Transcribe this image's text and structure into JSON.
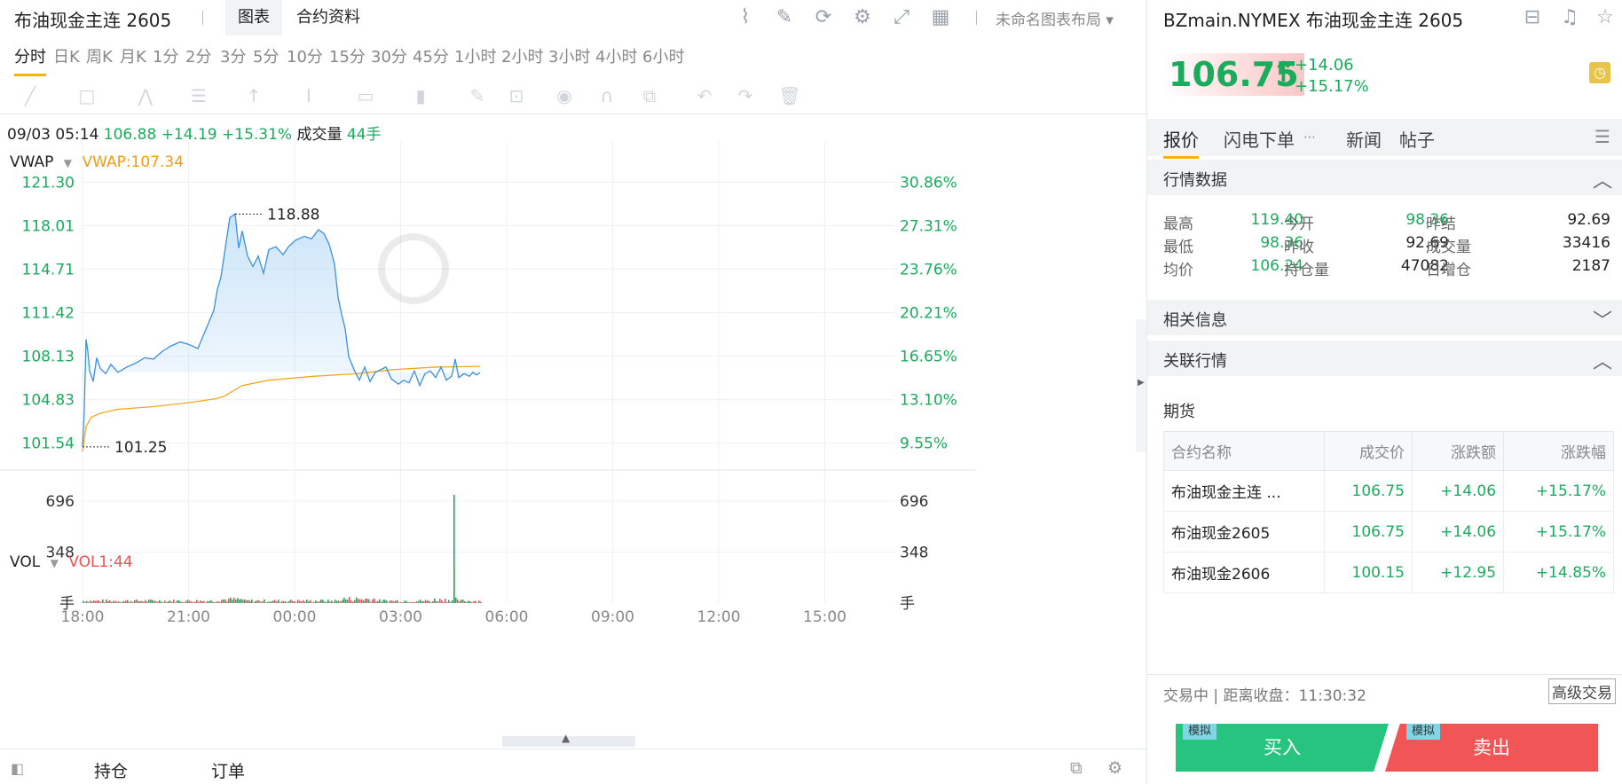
{
  "header": {
    "instrument_title": "布油现金主连 2605",
    "tabs": [
      "图表",
      "合约资料"
    ],
    "layout_name": "未命名图表布局"
  },
  "intervals": [
    "分时",
    "日K",
    "周K",
    "月K",
    "1分",
    "2分",
    "3分",
    "5分",
    "10分",
    "15分",
    "30分",
    "45分",
    "1小时",
    "2小时",
    "3小时",
    "4小时",
    "6小时"
  ],
  "info_line": {
    "datetime": "09/03 05:14",
    "price": "106.88",
    "change": "+14.19",
    "pct": "+15.31%",
    "volume_label": "成交量",
    "volume": "44手"
  },
  "indicators": {
    "vwap_name": "VWAP",
    "vwap_value": "VWAP:107.34",
    "vol_name": "VOL",
    "vol_value": "VOL1:44"
  },
  "chart_data": {
    "type": "line",
    "price_ticks": [
      "121.30",
      "118.01",
      "114.71",
      "111.42",
      "108.13",
      "104.83",
      "101.54"
    ],
    "pct_ticks": [
      "30.86%",
      "27.31%",
      "23.76%",
      "20.21%",
      "16.65%",
      "13.10%",
      "9.55%"
    ],
    "time_ticks": [
      "18:00",
      "21:00",
      "00:00",
      "03:00",
      "06:00",
      "09:00",
      "12:00",
      "15:00"
    ],
    "ylim": [
      99.5,
      123.0
    ],
    "high_marker": "118.88",
    "low_marker": "101.25",
    "vol_ticks": [
      "696",
      "348"
    ],
    "vol_unit": "手",
    "vol_max": 800,
    "series": [
      {
        "name": "VWAP",
        "color": "#f5a623",
        "x": [
          0,
          4,
          10,
          20,
          40,
          80,
          120,
          150,
          160,
          180,
          210,
          260,
          310,
          350,
          400,
          448
        ],
        "values": [
          100.9,
          102.8,
          103.5,
          103.8,
          104.1,
          104.3,
          104.6,
          104.9,
          105.1,
          105.9,
          106.3,
          106.6,
          106.8,
          107.1,
          107.3,
          107.34
        ]
      },
      {
        "name": "price",
        "color": "#3b8fe0",
        "x": [
          0,
          2,
          4,
          6,
          8,
          12,
          16,
          20,
          26,
          32,
          40,
          50,
          60,
          70,
          80,
          90,
          100,
          110,
          120,
          130,
          140,
          148,
          152,
          156,
          160,
          166,
          172,
          176,
          180,
          186,
          192,
          198,
          204,
          210,
          218,
          226,
          232,
          240,
          250,
          258,
          266,
          272,
          278,
          284,
          288,
          292,
          296,
          300,
          306,
          312,
          318,
          324,
          330,
          336,
          342,
          348,
          356,
          362,
          368,
          374,
          380,
          386,
          392,
          398,
          404,
          410,
          416,
          420,
          424,
          430,
          436,
          440,
          444,
          448
        ],
        "values": [
          101.25,
          104.0,
          109.4,
          108.5,
          107.0,
          106.2,
          108.0,
          107.2,
          106.8,
          107.5,
          106.9,
          107.3,
          107.6,
          108.0,
          107.9,
          108.5,
          108.9,
          109.2,
          109.0,
          108.7,
          110.3,
          111.6,
          113.2,
          114.1,
          115.9,
          118.6,
          118.9,
          116.3,
          117.6,
          115.7,
          114.9,
          115.7,
          114.4,
          116.2,
          116.4,
          115.8,
          116.4,
          116.9,
          117.2,
          117.0,
          117.7,
          117.4,
          116.6,
          115.1,
          112.6,
          111.3,
          110.2,
          108.1,
          107.1,
          106.3,
          107.3,
          106.2,
          106.9,
          107.1,
          107.3,
          106.4,
          106.0,
          106.3,
          106.1,
          107.0,
          105.9,
          106.8,
          107.0,
          106.5,
          107.3,
          106.3,
          106.6,
          107.9,
          106.5,
          106.8,
          106.6,
          106.9,
          106.7,
          106.88
        ]
      }
    ],
    "volume_peak": {
      "x": 418,
      "value": 740
    }
  },
  "bottom_tabs": [
    "持仓",
    "订单"
  ],
  "quote": {
    "title": "BZmain.NYMEX 布油现金主连 2605",
    "price": "106.75",
    "change": "+14.06",
    "pct": "+15.17%",
    "tabs": [
      "报价",
      "闪电下单",
      "新闻",
      "帖子"
    ],
    "market_data_title": "行情数据",
    "market_data": [
      [
        "最高",
        "119.40",
        "今开",
        "98.36",
        "昨结",
        "92.69"
      ],
      [
        "最低",
        "98.36",
        "昨收",
        "92.69",
        "成交量",
        "33416"
      ],
      [
        "均价",
        "106.24",
        "持仓量",
        "47082",
        "日增仓",
        "2187"
      ]
    ],
    "related_info_title": "相关信息",
    "related_quotes_title": "关联行情",
    "futures_label": "期货",
    "table_headers": [
      "合约名称",
      "成交价",
      "涨跌额",
      "涨跌幅"
    ],
    "table_rows": [
      [
        "布油现金主连 ...",
        "106.75",
        "+14.06",
        "+15.17%"
      ],
      [
        "布油现金2605",
        "106.75",
        "+14.06",
        "+15.17%"
      ],
      [
        "布油现金2606",
        "100.15",
        "+12.95",
        "+14.85%"
      ]
    ],
    "status": "交易中 | 距离收盘：11:30:32",
    "advanced_trade": "高级交易",
    "buy": "买入",
    "sell": "卖出",
    "sim_tag": "模拟"
  },
  "colors": {
    "up": "#1aac5c",
    "down": "#f0504f",
    "accent": "#f5b400",
    "vwap": "#f5a623",
    "line": "#3b8fe0"
  }
}
